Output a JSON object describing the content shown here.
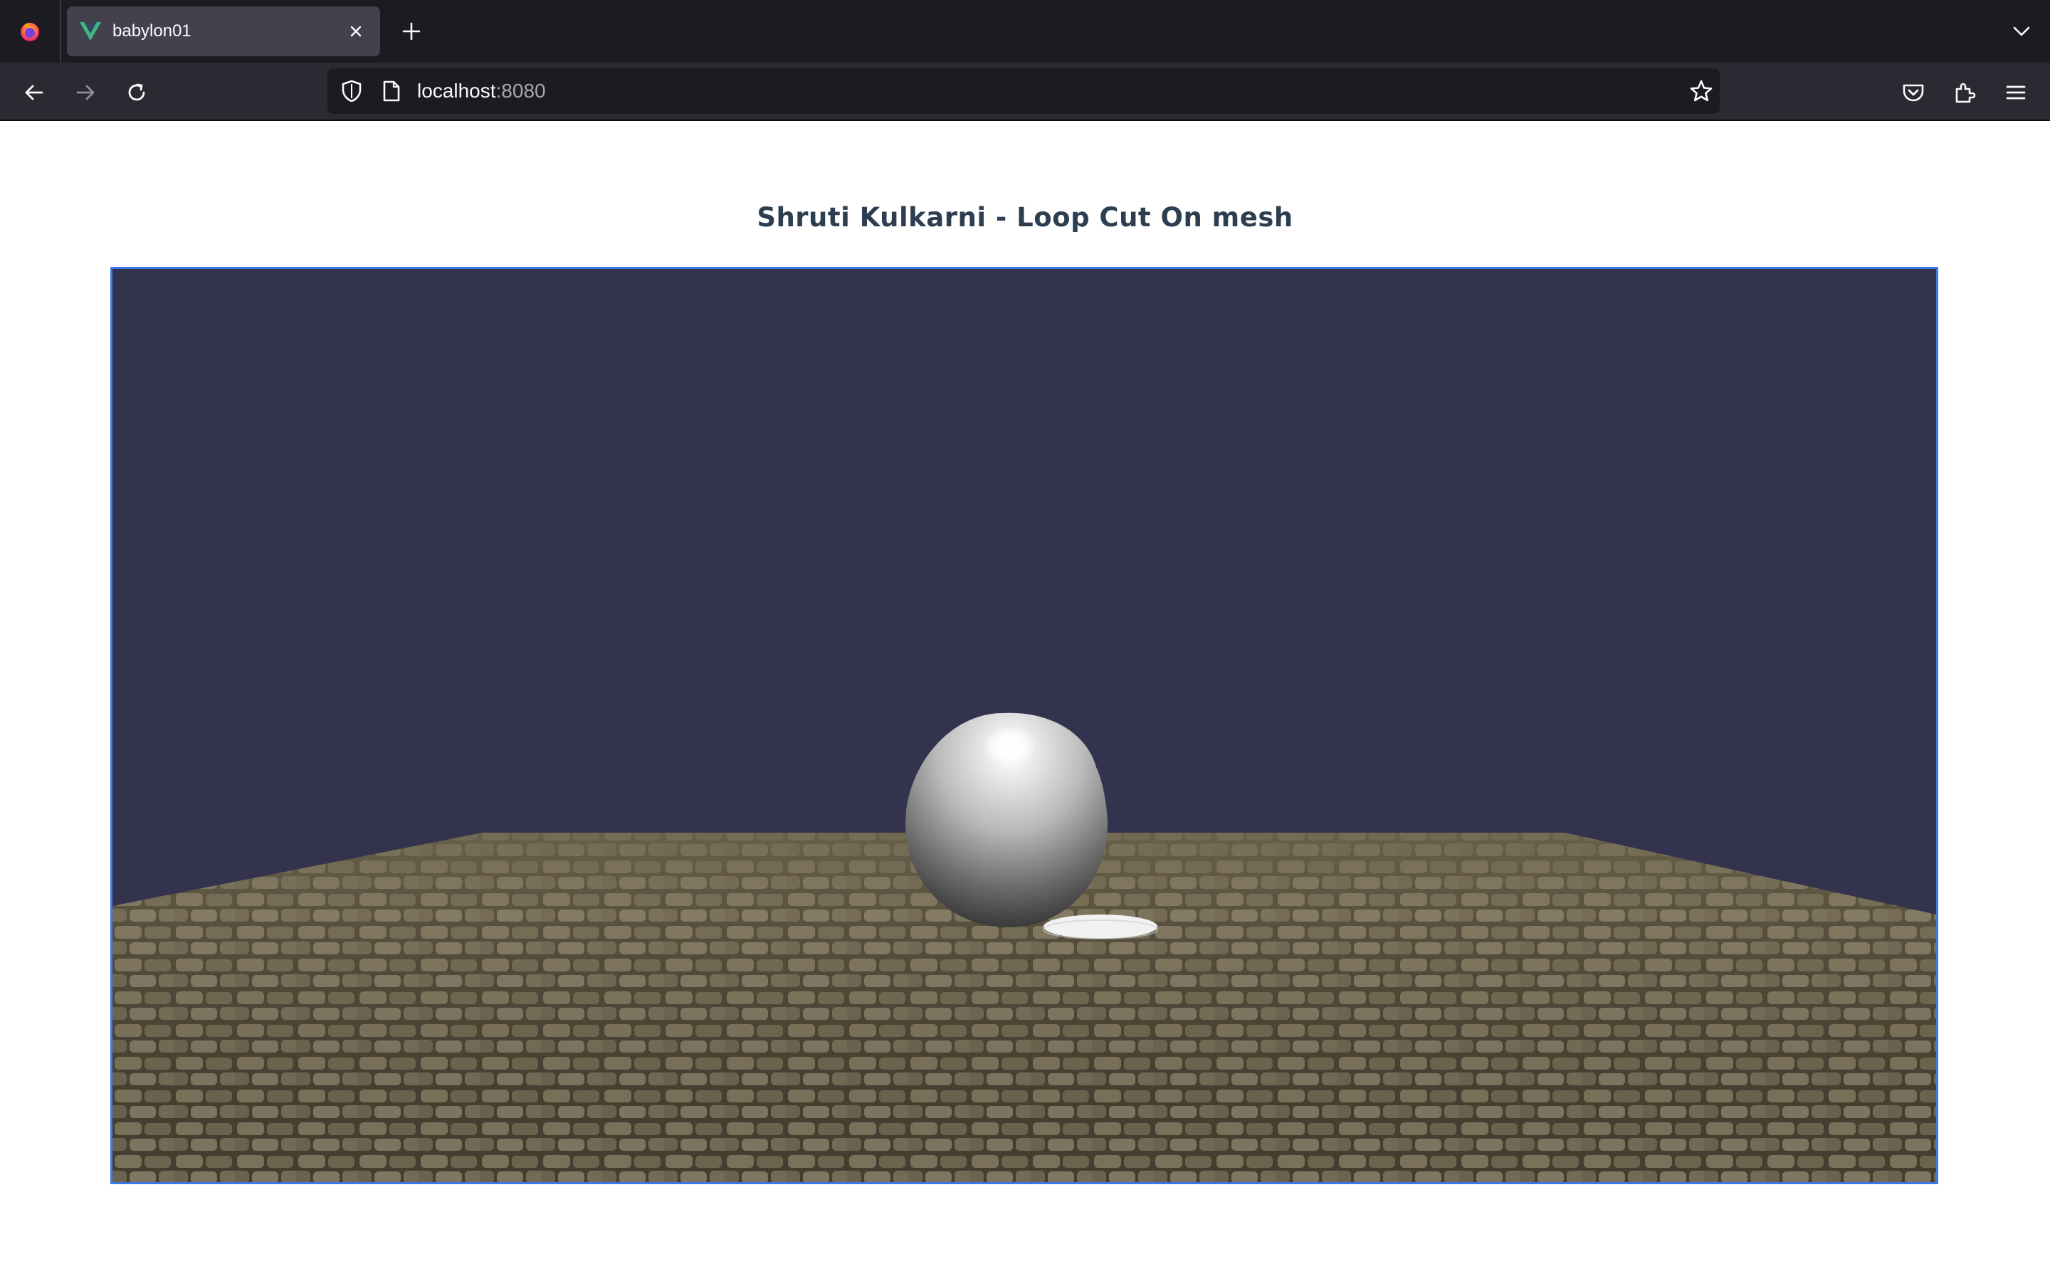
{
  "browser": {
    "tab": {
      "title": "babylon01",
      "favicon": "vue-logo-icon"
    },
    "toolbar": {
      "back": "back-arrow-icon",
      "forward": "forward-arrow-icon",
      "reload": "reload-icon"
    },
    "urlbar": {
      "host": "localhost",
      "port": ":8080"
    },
    "colors": {
      "tabbar_bg": "#1c1b22",
      "active_tab_bg": "#42414d",
      "navbar_bg": "#2b2a33",
      "urlbar_bg": "#1c1b22"
    }
  },
  "page": {
    "heading": "Shruti Kulkarni - Loop Cut On mesh",
    "scene": {
      "clear_color": "#33334d",
      "canvas_border_color": "#3b78e7",
      "meshes": [
        "sphere",
        "ground",
        "disc"
      ],
      "ground_texture": "cobblestone"
    }
  }
}
